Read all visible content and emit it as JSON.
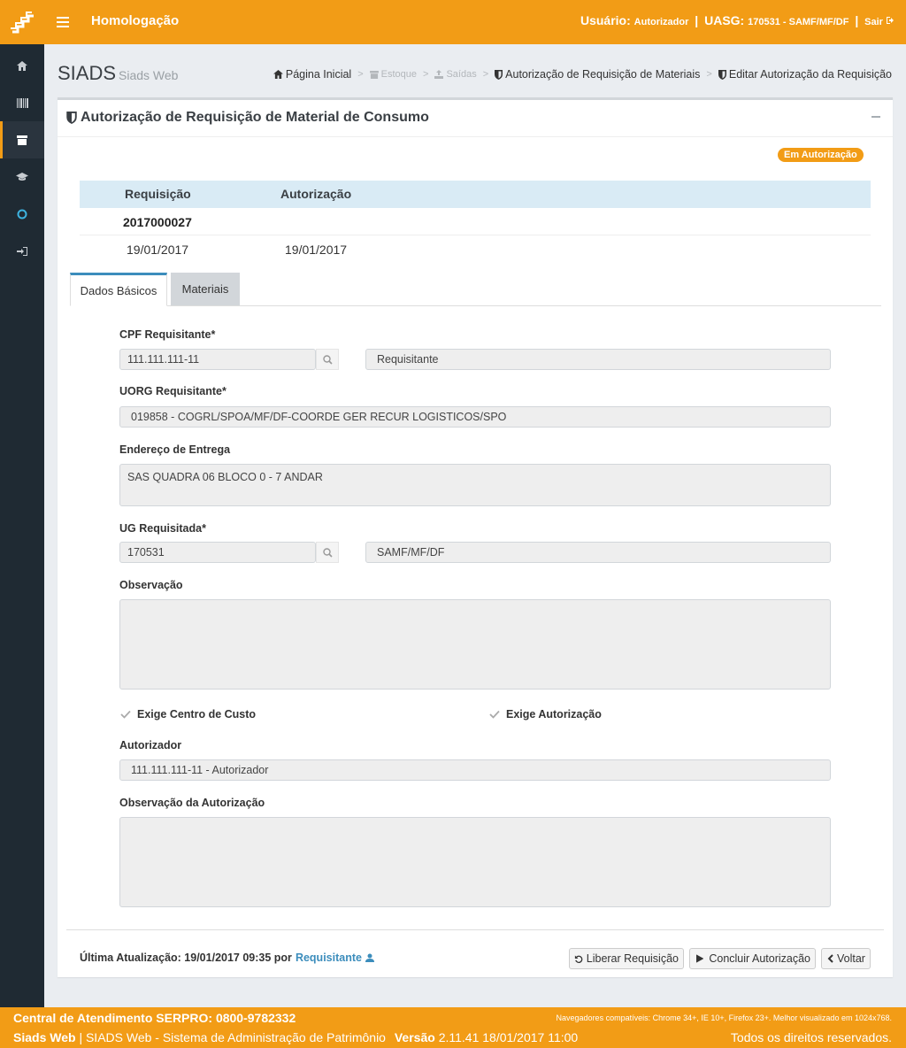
{
  "header": {
    "env_title": "Homologação",
    "user_label": "Usuário:",
    "user_value": "Autorizador",
    "uasg_label": "UASG:",
    "uasg_value": "170531 - SAMF/MF/DF",
    "logout_label": "Sair",
    "separator": "|"
  },
  "sidebar": {
    "items": [
      {
        "icon": "home-icon"
      },
      {
        "icon": "barcode-icon"
      },
      {
        "icon": "archive-icon",
        "active": true
      },
      {
        "icon": "graduation-cap-icon"
      },
      {
        "icon": "circle-icon"
      },
      {
        "icon": "sign-in-icon"
      }
    ]
  },
  "app": {
    "title": "SIADS",
    "subtitle": "Siads Web"
  },
  "breadcrumb": {
    "home": "Página Inicial",
    "estoque": "Estoque",
    "saidas": "Saídas",
    "autorizacao": "Autorização de Requisição de Materiais",
    "editar": "Editar Autorização da Requisição",
    "arrow": ">"
  },
  "panel": {
    "title": "Autorização de Requisição de Material de Consumo",
    "status_badge": "Em Autorização"
  },
  "requisicao_table": {
    "headers": [
      "Requisição",
      "Autorização"
    ],
    "number": "2017000027",
    "dates": [
      "19/01/2017",
      "19/01/2017"
    ]
  },
  "tabs": [
    {
      "label": "Dados Básicos",
      "active": true
    },
    {
      "label": "Materiais",
      "active": false
    }
  ],
  "form": {
    "cpf_label": "CPF Requisitante*",
    "cpf_value": "111.111.111-11",
    "requisitante_name": "Requisitante",
    "uorg_label": "UORG Requisitante*",
    "uorg_value": "019858 - COGRL/SPOA/MF/DF-COORDE GER RECUR LOGISTICOS/SPO",
    "endereco_label": "Endereço de Entrega",
    "endereco_value": "SAS QUADRA 06 BLOCO 0 - 7 ANDAR",
    "ug_label": "UG Requisitada*",
    "ug_value": "170531",
    "ug_name": "SAMF/MF/DF",
    "observacao_label": "Observação",
    "observacao_value": "",
    "exige_centro_custo": "Exige Centro de Custo",
    "exige_autorizacao": "Exige Autorização",
    "autorizador_label": "Autorizador",
    "autorizador_value": "111.111.111-11 - Autorizador",
    "obs_autorizacao_label": "Observação da Autorização",
    "obs_autorizacao_value": ""
  },
  "panel_footer": {
    "last_update_label": "Última Atualização: 19/01/2017 09:35 por",
    "last_update_user": "Requisitante",
    "btn_liberar": "Liberar Requisição",
    "btn_concluir": "Concluir Autorização",
    "btn_voltar": "Voltar"
  },
  "page_footer": {
    "central": "Central de Atendimento SERPRO: 0800-9782332",
    "browsers": "Navegadores compatíveis: Chrome 34+, IE 10+, Firefox 23+. Melhor visualizado em 1024x768.",
    "brand": "Siads Web",
    "system_name": "| SIADS Web - Sistema de Administração de Patrimônio",
    "version_label": "Versão",
    "version_value": "2.11.41 18/01/2017 11:00",
    "rights": "Todos os direitos reservados."
  },
  "colors": {
    "brand_orange": "#f29c16",
    "sidebar_dark": "#1f2a33",
    "table_head_blue": "#d9ebf5",
    "link_blue": "#3c8dbc"
  }
}
